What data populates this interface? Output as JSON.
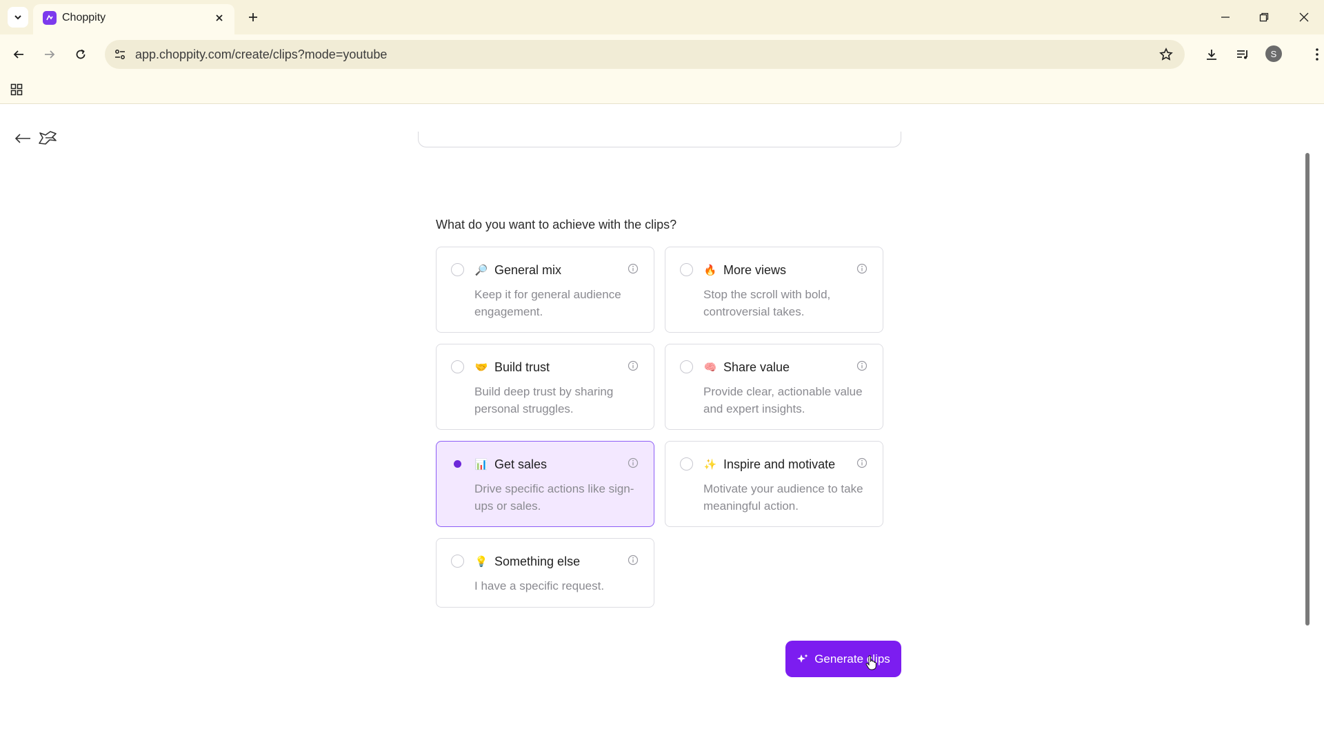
{
  "browser": {
    "tab_title": "Choppity",
    "url": "app.choppity.com/create/clips?mode=youtube",
    "profile_initial": "S"
  },
  "page": {
    "question": "What do you want to achieve with the clips?",
    "selected_option": "Get sales",
    "options": [
      {
        "title": "General mix",
        "description": "Keep it for general audience engagement.",
        "icon": "magnifier-emoji",
        "emoji": "🔎"
      },
      {
        "title": "More views",
        "description": "Stop the scroll with bold, controversial takes.",
        "icon": "fire-emoji",
        "emoji": "🔥"
      },
      {
        "title": "Build trust",
        "description": "Build deep trust by sharing personal struggles.",
        "icon": "handshake-emoji",
        "emoji": "🤝"
      },
      {
        "title": "Share value",
        "description": "Provide clear, actionable value and expert insights.",
        "icon": "brain-emoji",
        "emoji": "🧠"
      },
      {
        "title": "Get sales",
        "description": "Drive specific actions like sign-ups or sales.",
        "icon": "bar-chart-emoji",
        "emoji": "📊"
      },
      {
        "title": "Inspire and motivate",
        "description": "Motivate your audience to take meaningful action.",
        "icon": "sparkles-emoji",
        "emoji": "✨"
      },
      {
        "title": "Something else",
        "description": "I have a specific request.",
        "icon": "lightbulb-emoji",
        "emoji": "💡"
      }
    ],
    "generate_label": "Generate clips"
  },
  "colors": {
    "accent": "#7c1df0",
    "selected_bg": "#f3e8ff",
    "chrome_bg": "#fefbed"
  }
}
